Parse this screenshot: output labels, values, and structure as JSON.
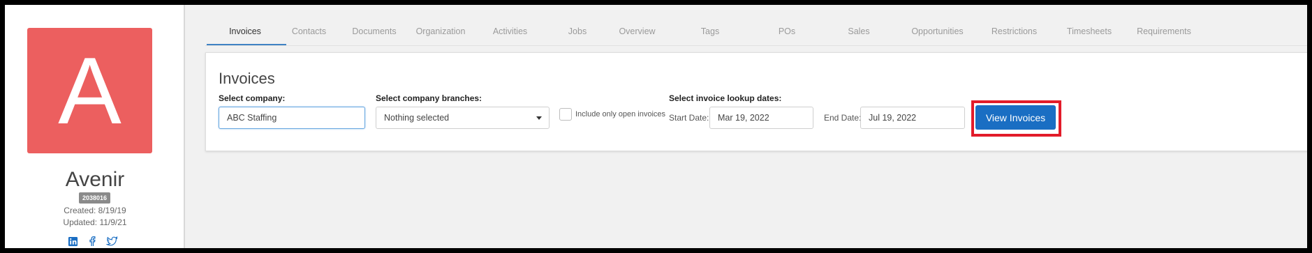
{
  "profile": {
    "avatar_letter": "A",
    "avatar_color": "#ec5f5f",
    "name": "Avenir",
    "id": "2038016",
    "created": "Created: 8/19/19",
    "updated": "Updated: 11/9/21",
    "social_icons": [
      "linkedin-icon",
      "facebook-icon",
      "twitter-icon"
    ]
  },
  "tabs": [
    {
      "label": "Invoices",
      "active": true
    },
    {
      "label": "Contacts"
    },
    {
      "label": "Documents"
    },
    {
      "label": "Organization"
    },
    {
      "label": "Activities"
    },
    {
      "label": "Jobs"
    },
    {
      "label": "Overview"
    },
    {
      "label": "Tags"
    },
    {
      "label": "POs"
    },
    {
      "label": "Sales"
    },
    {
      "label": "Opportunities"
    },
    {
      "label": "Restrictions"
    },
    {
      "label": "Timesheets"
    },
    {
      "label": "Requirements"
    }
  ],
  "invoices": {
    "title": "Invoices",
    "company_label": "Select company:",
    "company_value": "ABC Staffing",
    "branches_label": "Select company branches:",
    "branches_value": "Nothing selected",
    "open_only_label": "Include only open invoices",
    "open_only_checked": false,
    "dates_label": "Select invoice lookup dates:",
    "start_label": "Start Date:",
    "start_value": "Mar 19, 2022",
    "end_label": "End Date:",
    "end_value": "Jul 19, 2022",
    "view_button": "View Invoices"
  },
  "colors": {
    "accent": "#1a6ec3",
    "highlight": "#e21c2a"
  }
}
